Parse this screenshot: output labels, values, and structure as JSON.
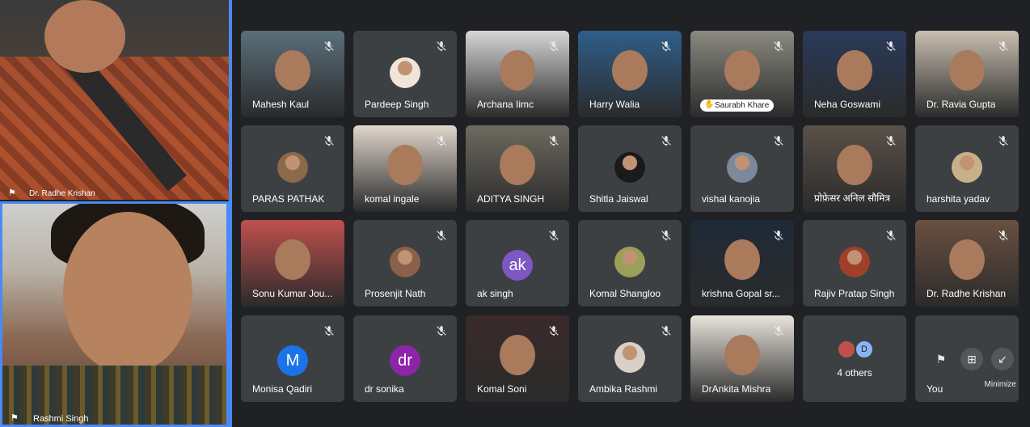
{
  "speakers": [
    {
      "name": "Dr. Radhe Krishan"
    },
    {
      "name": "Rashmi Singh"
    }
  ],
  "grid": [
    {
      "name": "Mahesh Kaul",
      "kind": "video",
      "muted": true,
      "bg": "#5a6e7a"
    },
    {
      "name": "Pardeep Singh",
      "kind": "photo",
      "muted": true,
      "avatar_color": "#f0e5d8"
    },
    {
      "name": "Archana Iimc",
      "kind": "video",
      "muted": true,
      "bg": "#d6d6d6"
    },
    {
      "name": "Harry Walia",
      "kind": "video",
      "muted": true,
      "bg": "#2f5e8a"
    },
    {
      "name": "Saurabh Khare",
      "kind": "video",
      "muted": true,
      "bg": "#8a8a80",
      "hand_raised": true
    },
    {
      "name": "Neha Goswami",
      "kind": "video",
      "muted": true,
      "bg": "#2a3a5a"
    },
    {
      "name": "Dr. Ravia Gupta",
      "kind": "video",
      "muted": true,
      "bg": "#c9bfb1"
    },
    {
      "name": "PARAS PATHAK",
      "kind": "photo",
      "muted": true,
      "avatar_color": "#8a6a4a"
    },
    {
      "name": "komal ingale",
      "kind": "video",
      "muted": true,
      "bg": "#e0d6cc"
    },
    {
      "name": "ADITYA SINGH",
      "kind": "video",
      "muted": true,
      "bg": "#6e6a60"
    },
    {
      "name": "Shitla Jaiswal",
      "kind": "photo",
      "muted": true,
      "avatar_color": "#1a1a1a"
    },
    {
      "name": "vishal kanojia",
      "kind": "photo",
      "muted": true,
      "avatar_color": "#7a8a9a"
    },
    {
      "name": "प्रोफ़ेसर अनिल सौमित्र",
      "kind": "video",
      "muted": true,
      "bg": "#5a5048"
    },
    {
      "name": "harshita yadav",
      "kind": "photo",
      "muted": true,
      "avatar_color": "#c8b08a"
    },
    {
      "name": "Sonu Kumar Jou...",
      "kind": "video",
      "muted": false,
      "bg": "#c0504d"
    },
    {
      "name": "Prosenjit Nath",
      "kind": "photo",
      "muted": true,
      "avatar_color": "#8a6048"
    },
    {
      "name": "ak singh",
      "kind": "letter",
      "letter": "ak",
      "muted": true,
      "avatar_color": "#7e57c2"
    },
    {
      "name": "Komal Shangloo",
      "kind": "photo",
      "muted": true,
      "avatar_color": "#9aa05a"
    },
    {
      "name": "krishna Gopal sr...",
      "kind": "video",
      "muted": true,
      "bg": "#1e2a38"
    },
    {
      "name": "Rajiv Pratap Singh",
      "kind": "photo",
      "muted": true,
      "avatar_color": "#a0402a"
    },
    {
      "name": "Dr. Radhe Krishan",
      "kind": "video",
      "muted": true,
      "bg": "#6a5040"
    },
    {
      "name": "Monisa Qadiri",
      "kind": "letter",
      "letter": "M",
      "muted": true,
      "avatar_color": "#1a73e8"
    },
    {
      "name": "dr sonika",
      "kind": "letter",
      "letter": "dr",
      "muted": true,
      "avatar_color": "#8e24aa"
    },
    {
      "name": "Komal Soni",
      "kind": "video",
      "muted": true,
      "bg": "#3a2a2a"
    },
    {
      "name": "Ambika Rashmi",
      "kind": "photo",
      "muted": true,
      "avatar_color": "#d8d0c6"
    },
    {
      "name": "DrAnkita Mishra",
      "kind": "video",
      "muted": true,
      "bg": "#e8e4dc"
    }
  ],
  "others": {
    "label": "4 others",
    "letter": "D"
  },
  "self": {
    "name": "You",
    "minimize_label": "Minimize"
  },
  "icons": {
    "mute": "mic-off-icon",
    "pin": "pin-icon",
    "hand": "hand-raised-icon"
  },
  "colors": {
    "background": "#202124",
    "tile": "#3c4043",
    "accent": "#4a8af4"
  }
}
